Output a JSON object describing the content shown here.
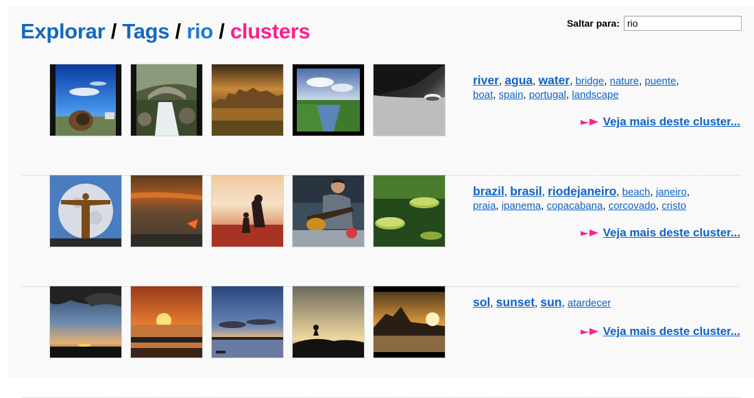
{
  "breadcrumb": {
    "explore": "Explorar",
    "tags": "Tags",
    "tag": "rio",
    "current": "clusters",
    "separator": "/"
  },
  "jump": {
    "label": "Saltar para:",
    "value": "rio"
  },
  "colors": {
    "title_blue": "#1469bd",
    "link_blue": "#0e63c8",
    "accent_pink": "#ff1f8a"
  },
  "clusters": [
    {
      "tags_big": [
        "river",
        "agua",
        "water"
      ],
      "tags_small": [
        "bridge",
        "nature",
        "puente",
        "boat",
        "spain",
        "portugal",
        "landscape"
      ],
      "more": "Veja mais deste cluster..."
    },
    {
      "tags_big": [
        "brazil",
        "brasil",
        "riodejaneiro"
      ],
      "tags_small": [
        "beach",
        "janeiro",
        "praia",
        "ipanema",
        "copacabana",
        "corcovado",
        "cristo"
      ],
      "more": "Veja mais deste cluster..."
    },
    {
      "tags_big": [
        "sol",
        "sunset",
        "sun"
      ],
      "tags_small": [
        "atardecer"
      ],
      "more": "Veja mais deste cluster..."
    }
  ]
}
